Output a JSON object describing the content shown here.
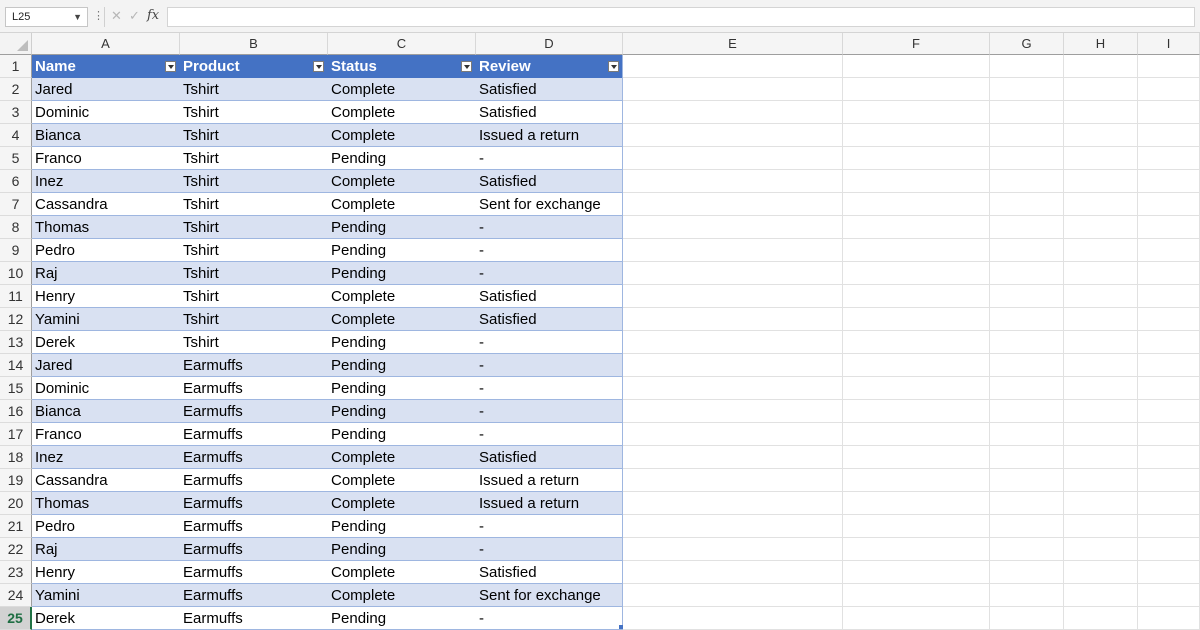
{
  "formula_bar": {
    "name_box": "L25",
    "cancel_glyph": "✕",
    "enter_glyph": "✓",
    "fx_label": "fx",
    "formula_value": ""
  },
  "sheet": {
    "columns": [
      "A",
      "B",
      "C",
      "D",
      "E",
      "F",
      "G",
      "H",
      "I"
    ],
    "row_numbers": [
      "1",
      "2",
      "3",
      "4",
      "5",
      "6",
      "7",
      "8",
      "9",
      "10",
      "11",
      "12",
      "13",
      "14",
      "15",
      "16",
      "17",
      "18",
      "19",
      "20",
      "21",
      "22",
      "23",
      "24",
      "25"
    ],
    "selected_row": "25",
    "table_header_color": "#4472c4",
    "table_band_color": "#d9e1f2",
    "table": {
      "headers": [
        "Name",
        "Product",
        "Status",
        "Review"
      ],
      "rows": [
        [
          "Jared",
          "Tshirt",
          "Complete",
          "Satisfied"
        ],
        [
          "Dominic",
          "Tshirt",
          "Complete",
          "Satisfied"
        ],
        [
          "Bianca",
          "Tshirt",
          "Complete",
          "Issued a return"
        ],
        [
          "Franco",
          "Tshirt",
          "Pending",
          "-"
        ],
        [
          "Inez",
          "Tshirt",
          "Complete",
          "Satisfied"
        ],
        [
          "Cassandra",
          "Tshirt",
          "Complete",
          "Sent for exchange"
        ],
        [
          "Thomas",
          "Tshirt",
          "Pending",
          "-"
        ],
        [
          "Pedro",
          "Tshirt",
          "Pending",
          "-"
        ],
        [
          "Raj",
          "Tshirt",
          "Pending",
          "-"
        ],
        [
          "Henry",
          "Tshirt",
          "Complete",
          "Satisfied"
        ],
        [
          "Yamini",
          "Tshirt",
          "Complete",
          "Satisfied"
        ],
        [
          "Derek",
          "Tshirt",
          "Pending",
          "-"
        ],
        [
          "Jared",
          "Earmuffs",
          "Pending",
          "-"
        ],
        [
          "Dominic",
          "Earmuffs",
          "Pending",
          "-"
        ],
        [
          "Bianca",
          "Earmuffs",
          "Pending",
          "-"
        ],
        [
          "Franco",
          "Earmuffs",
          "Pending",
          "-"
        ],
        [
          "Inez",
          "Earmuffs",
          "Complete",
          "Satisfied"
        ],
        [
          "Cassandra",
          "Earmuffs",
          "Complete",
          "Issued a return"
        ],
        [
          "Thomas",
          "Earmuffs",
          "Complete",
          "Issued a return"
        ],
        [
          "Pedro",
          "Earmuffs",
          "Pending",
          "-"
        ],
        [
          "Raj",
          "Earmuffs",
          "Pending",
          "-"
        ],
        [
          "Henry",
          "Earmuffs",
          "Complete",
          "Satisfied"
        ],
        [
          "Yamini",
          "Earmuffs",
          "Complete",
          "Sent for exchange"
        ],
        [
          "Derek",
          "Earmuffs",
          "Pending",
          "-"
        ]
      ]
    }
  }
}
